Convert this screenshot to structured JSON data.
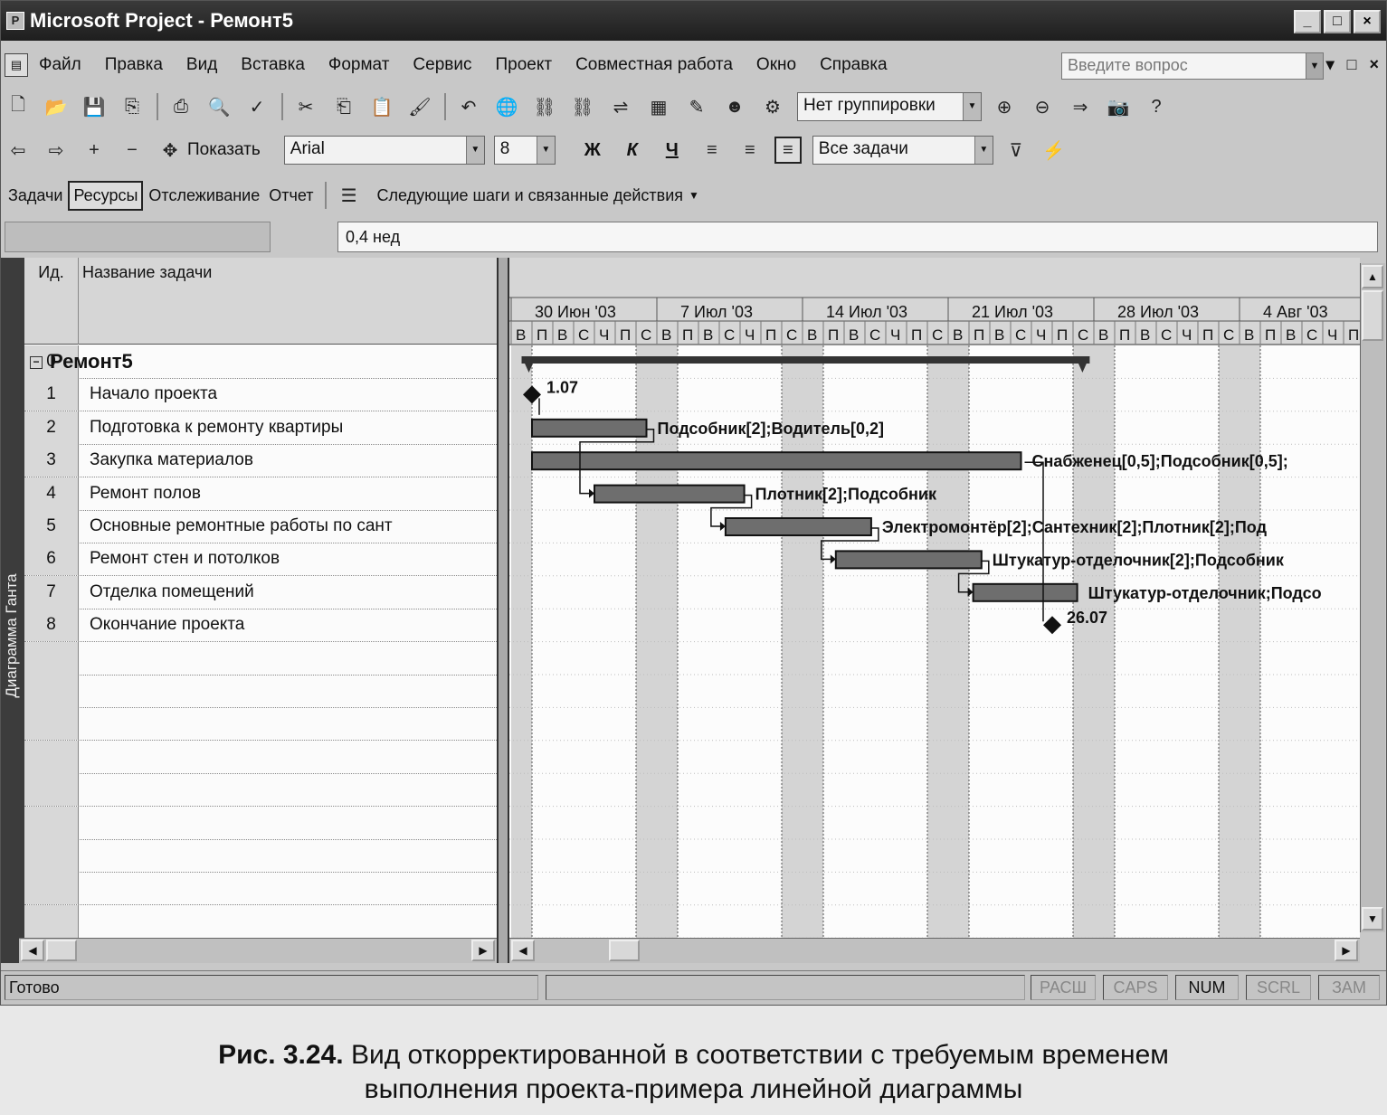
{
  "window": {
    "title": "Microsoft Project - Ремонт5",
    "app_icon": "project-icon",
    "buttons": [
      "_",
      "□",
      "×"
    ]
  },
  "menu": {
    "items": [
      "Файл",
      "Правка",
      "Вид",
      "Вставка",
      "Формат",
      "Сервис",
      "Проект",
      "Совместная работа",
      "Окно",
      "Справка"
    ],
    "ask_placeholder": "Введите вопрос",
    "doc_buttons": [
      "▾",
      "□",
      "×"
    ]
  },
  "toolbar1": {
    "grouping": "Нет группировки"
  },
  "toolbar2": {
    "show": "Показать",
    "font": "Arial",
    "size": "8",
    "bold": "Ж",
    "italic": "К",
    "underline": "Ч",
    "filter": "Все задачи"
  },
  "toolbar3": {
    "tabs": [
      "Задачи",
      "Ресурсы",
      "Отслеживание",
      "Отчет"
    ],
    "active_tab": "Ресурсы",
    "next_steps": "Следующие шаги и связанные действия"
  },
  "entry": {
    "value": "0,4 нед"
  },
  "sidebar": {
    "label": "Диаграмма Ганта"
  },
  "table": {
    "headers": {
      "id": "Ид.",
      "name": "Название задачи"
    },
    "rows": [
      {
        "id": "0",
        "name": "Ремонт5",
        "summary": true
      },
      {
        "id": "1",
        "name": "Начало проекта"
      },
      {
        "id": "2",
        "name": "Подготовка к ремонту квартиры"
      },
      {
        "id": "3",
        "name": "Закупка материалов"
      },
      {
        "id": "4",
        "name": "Ремонт полов"
      },
      {
        "id": "5",
        "name": "Основные ремонтные работы по сант"
      },
      {
        "id": "6",
        "name": "Ремонт стен и потолков"
      },
      {
        "id": "7",
        "name": "Отделка помещений"
      },
      {
        "id": "8",
        "name": "Окончание проекта"
      }
    ]
  },
  "gantt": {
    "weeks": [
      "30 Июн '03",
      "7 Июл '03",
      "14 Июл '03",
      "21 Июл '03",
      "28 Июл '03",
      "4 Авг '03"
    ],
    "days": [
      "В",
      "П",
      "В",
      "С",
      "Ч",
      "П",
      "С"
    ],
    "milestones": [
      {
        "task": "1",
        "label": "1.07",
        "day": 1
      },
      {
        "task": "8",
        "label": "26.07",
        "day": 26
      }
    ],
    "bars": [
      {
        "task": "2",
        "start": 1,
        "end": 6.5,
        "label": "Подсобник[2];Водитель[0,2]"
      },
      {
        "task": "3",
        "start": 1,
        "end": 24.5,
        "label": "Снабженец[0,5];Подсобник[0,5];"
      },
      {
        "task": "4",
        "start": 4,
        "end": 11.2,
        "label": "Плотник[2];Подсобник"
      },
      {
        "task": "5",
        "start": 10.3,
        "end": 17.3,
        "label": "Электромонтёр[2];Сантехник[2];Плотник[2];Под"
      },
      {
        "task": "6",
        "start": 15.6,
        "end": 22.6,
        "label": "Штукатур-отделочник[2];Подсобник"
      },
      {
        "task": "7",
        "start": 22.2,
        "end": 27.2,
        "label": "Штукатур-отделочник;Подсо"
      }
    ],
    "summary": {
      "start": 0.5,
      "end": 27.8
    }
  },
  "status": {
    "ready": "Готово",
    "indicators": [
      "РАСШ",
      "CAPS",
      "NUM",
      "SCRL",
      "ЗАМ"
    ],
    "active": "NUM"
  },
  "caption": {
    "label": "Рис. 3.24.",
    "text": "Вид откорректированной в соответствии с требуемым временем",
    "text2": "выполнения проекта-примера линейной диаграммы"
  }
}
